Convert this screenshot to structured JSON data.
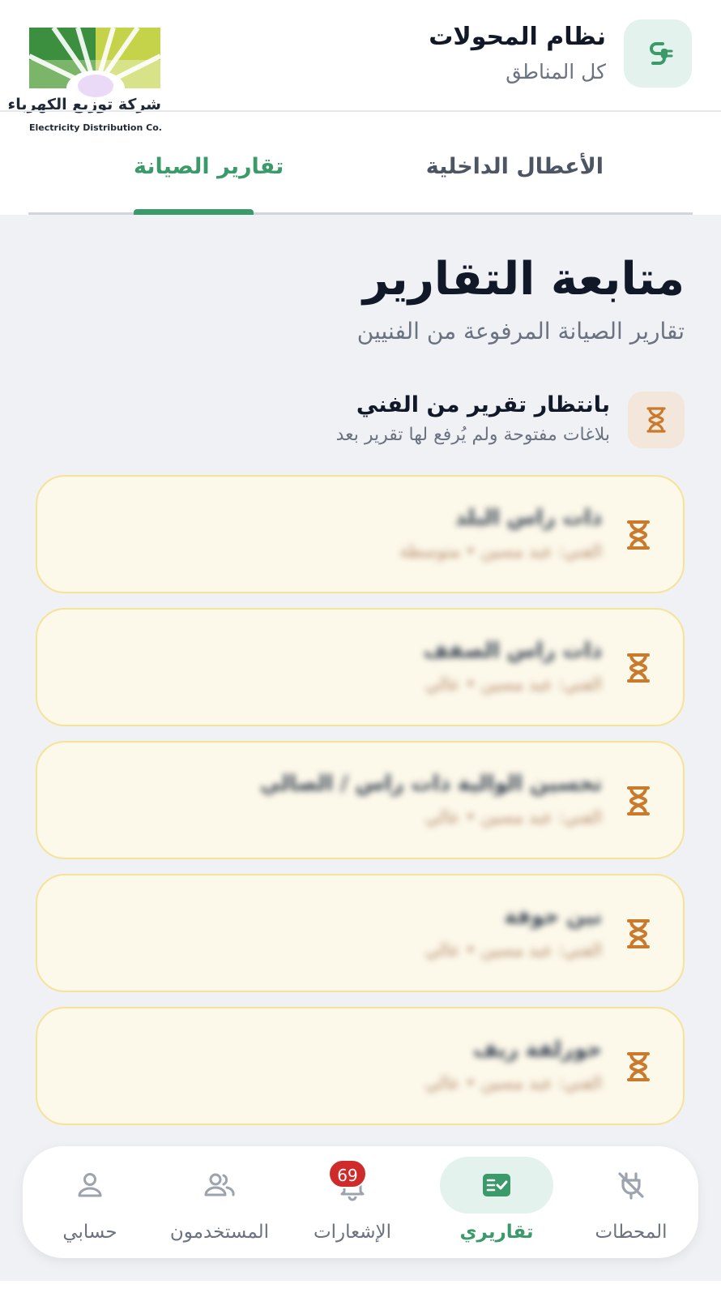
{
  "header": {
    "title": "نظام المحولات",
    "subtitle": "كل المناطق",
    "logo_text_ar": "شركة توزيع الكهرباء",
    "logo_text_en": "Electricity Distribution Co."
  },
  "tabs": [
    {
      "label": "الأعطال الداخلية",
      "active": false
    },
    {
      "label": "تقارير الصيانة",
      "active": true
    }
  ],
  "page": {
    "title": "متابعة التقارير",
    "subtitle": "تقارير الصيانة المرفوعة من الفنيين"
  },
  "section": {
    "title": "بانتظار تقرير من الفني",
    "subtitle": "بلاغات مفتوحة ولم يُرفع لها تقرير بعد",
    "icon": "hourglass-icon"
  },
  "cards": [
    {
      "title": "ذات راس البلد",
      "meta": "الفني: عبد مسين • متوسطة"
    },
    {
      "title": "ذات راس الصفف",
      "meta": "الفني: عبد مسين • عالي"
    },
    {
      "title": "تحسين الوالية ذات راس / الصالي",
      "meta": "الفني: عبد مسين • عالي"
    },
    {
      "title": "نين حوفة",
      "meta": "الفني: عبد مسين • عالي"
    },
    {
      "title": "حورلفة ريف",
      "meta": "الفني: عبد مسين • عالي"
    }
  ],
  "bottom_nav": [
    {
      "label": "المحطات",
      "icon": "unplugged-icon",
      "active": false
    },
    {
      "label": "تقاريري",
      "icon": "report-check-icon",
      "active": true
    },
    {
      "label": "الإشعارات",
      "icon": "bell-icon",
      "active": false,
      "badge": "69"
    },
    {
      "label": "المستخدمون",
      "icon": "users-icon",
      "active": false
    },
    {
      "label": "حسابي",
      "icon": "user-icon",
      "active": false
    }
  ],
  "colors": {
    "accent": "#3b9a6a",
    "pending": "#c97a2c",
    "card_bg": "#fcf8ea",
    "card_border": "#f6e39a",
    "badge": "#cf2b2b"
  }
}
